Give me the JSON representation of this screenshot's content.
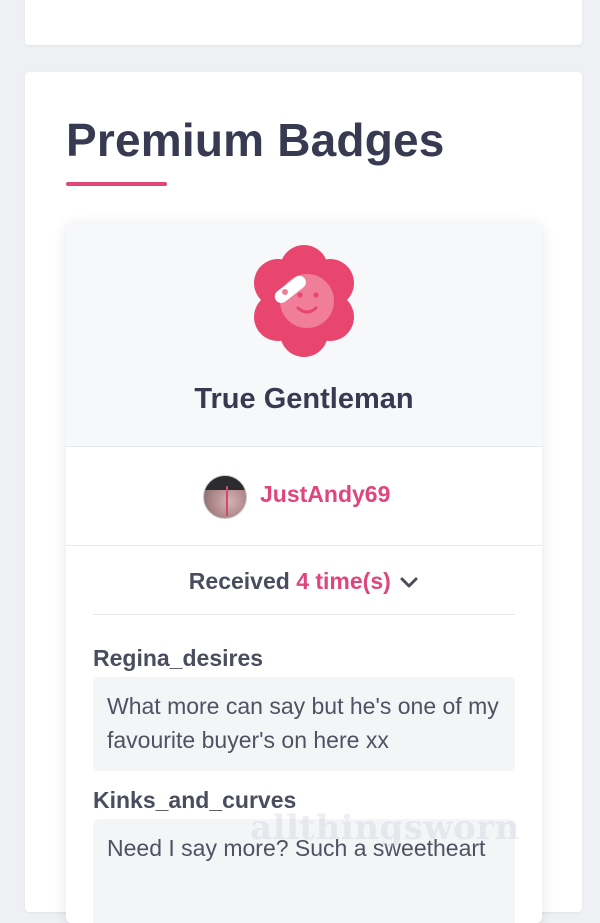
{
  "section": {
    "title": "Premium Badges"
  },
  "badge": {
    "name": "True Gentleman",
    "icon": "flower-smiley-badge-icon",
    "color": "#e0457b",
    "owner": {
      "username": "JustAndy69",
      "avatar": "avatar"
    },
    "received": {
      "label": "Received",
      "count_text": "4 time(s)",
      "toggle_icon": "chevron-down-icon"
    },
    "reviews": [
      {
        "author": "Regina_desires",
        "text": "What more can say but he's one of my favourite buyer's on here xx"
      },
      {
        "author": "Kinks_and_curves",
        "text": "Need I say more? Such a sweetheart"
      }
    ]
  },
  "watermark": "allthingsworn",
  "colors": {
    "accent": "#e0457b",
    "heading": "#383a52",
    "page_bg": "#eef0f4"
  }
}
